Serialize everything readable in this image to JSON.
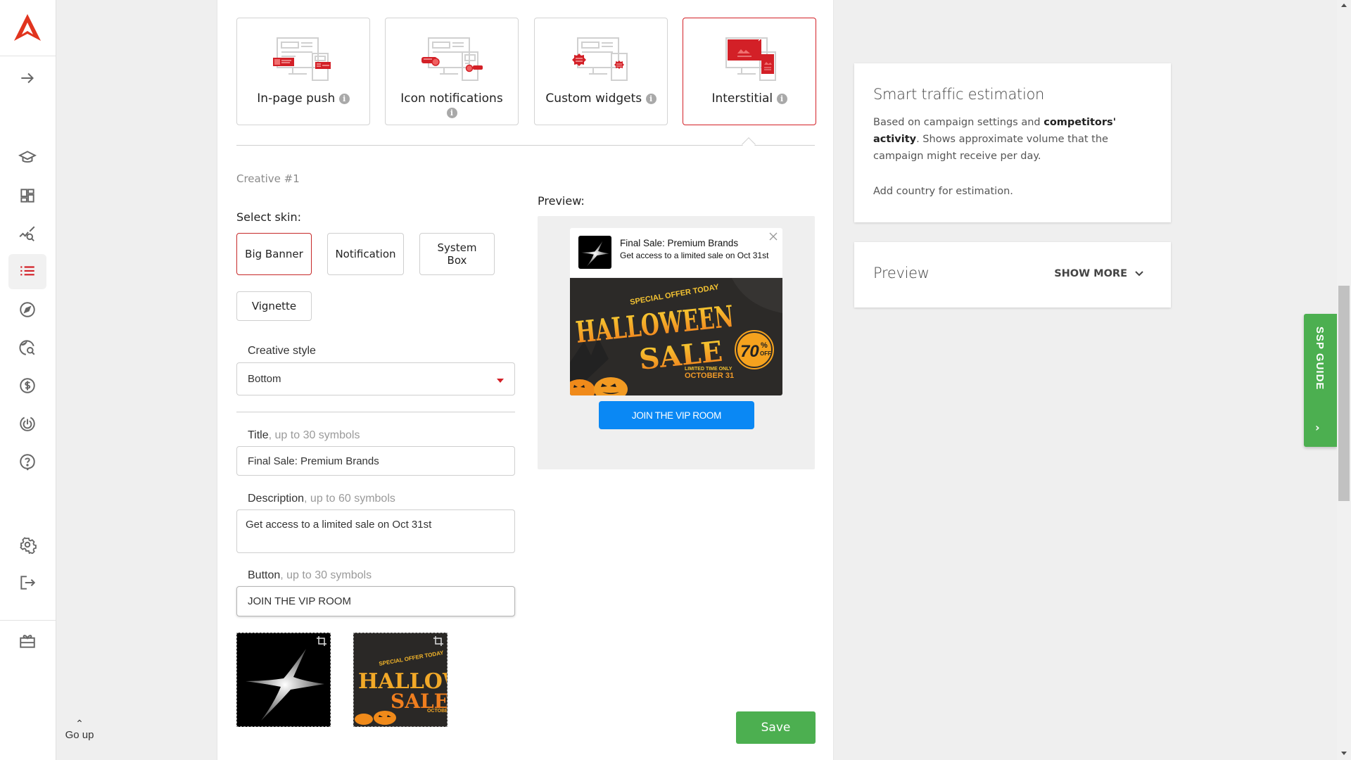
{
  "sidebar": {
    "logo": "adsterra-logo",
    "items": [
      {
        "name": "expand",
        "icon": "arrow-right-icon"
      },
      {
        "name": "education",
        "icon": "graduation-cap-icon"
      },
      {
        "name": "dashboard",
        "icon": "dashboard-grid-icon"
      },
      {
        "name": "statistics",
        "icon": "chart-search-icon"
      },
      {
        "name": "campaigns",
        "icon": "list-icon",
        "active": true
      },
      {
        "name": "explore",
        "icon": "compass-icon"
      },
      {
        "name": "traffic-research",
        "icon": "globe-search-icon"
      },
      {
        "name": "finance",
        "icon": "dollar-icon"
      },
      {
        "name": "tracking",
        "icon": "target-icon"
      },
      {
        "name": "support",
        "icon": "help-bubble-icon"
      },
      {
        "name": "settings",
        "icon": "gear-icon"
      },
      {
        "name": "logout",
        "icon": "logout-icon"
      },
      {
        "name": "referral",
        "icon": "gift-icon"
      }
    ]
  },
  "go_up": {
    "label": "Go up"
  },
  "ad_formats": [
    {
      "label": "In-page push",
      "selected": false
    },
    {
      "label": "Icon notifications",
      "selected": false
    },
    {
      "label": "Custom widgets",
      "selected": false
    },
    {
      "label": "Interstitial",
      "selected": true
    }
  ],
  "creative": {
    "label": "Creative #1",
    "skin_label": "Select skin:",
    "skins": [
      {
        "label": "Big Banner",
        "selected": true
      },
      {
        "label": "Notification",
        "selected": false
      },
      {
        "label": "System Box",
        "selected": false
      },
      {
        "label": "Vignette",
        "selected": false
      }
    ],
    "style": {
      "label": "Creative style",
      "value": "Bottom"
    },
    "title": {
      "label": "Title",
      "hint": ", up to 30 symbols",
      "value": "Final Sale: Premium Brands"
    },
    "description": {
      "label": "Description",
      "hint": ", up to 60 symbols",
      "value": "Get access to a limited sale on Oct 31st"
    },
    "button": {
      "label": "Button",
      "hint": ", up to 30 symbols",
      "value": "JOIN THE VIP ROOM"
    },
    "images": [
      {
        "name": "icon-image",
        "alt": "Silver star"
      },
      {
        "name": "banner-image",
        "alt": "Halloween Sale"
      }
    ]
  },
  "preview": {
    "label": "Preview:",
    "notification_title": "Final Sale: Premium Brands",
    "notification_desc": "Get access to a limited sale on Oct 31st",
    "banner": {
      "top_text": "SPECIAL OFFER TODAY",
      "headline1": "HALLOWEEN",
      "headline2": "SALE",
      "discount": "70",
      "discount_suffix": "%",
      "discount_off": "OFF",
      "limited": "LIMITED TIME ONLY",
      "date": "OCTOBER 31"
    },
    "cta": "JOIN THE VIP ROOM"
  },
  "save_label": "Save",
  "smart_traffic": {
    "title": "Smart traffic estimation",
    "text_pre": "Based on campaign settings and ",
    "text_bold": "competitors' activity",
    "text_post": ". Shows approximate volume that the campaign might receive per day.",
    "note": "Add country for estimation."
  },
  "preview_card": {
    "title": "Preview",
    "show_more": "SHOW MORE"
  },
  "ssp_guide": {
    "label": "SSP GUIDE"
  },
  "colors": {
    "accent": "#d32027",
    "save": "#4caf50",
    "cta": "#0a88f4",
    "ssp": "#4caf50"
  }
}
